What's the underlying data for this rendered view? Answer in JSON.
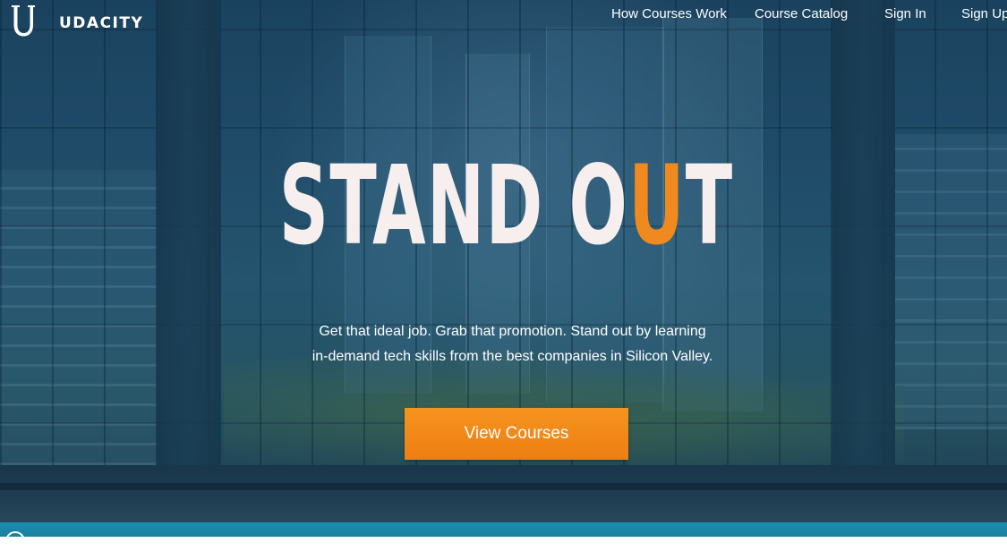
{
  "brand": {
    "name": "UDACITY",
    "logo_icon": "udacity-u-icon"
  },
  "nav": {
    "items": [
      {
        "label": "How Courses Work"
      },
      {
        "label": "Course Catalog"
      },
      {
        "label": "Sign In"
      },
      {
        "label": "Sign Up"
      }
    ]
  },
  "hero": {
    "headline_part1": "STAND O",
    "headline_accent": "U",
    "headline_part2": "T",
    "subtext_line1": "Get that ideal job. Grab that promotion. Stand out by learning",
    "subtext_line2": "in-demand tech skills from the best companies in Silicon Valley.",
    "cta_label": "View Courses"
  },
  "colors": {
    "accent": "#f0891e",
    "button": "#f5931f",
    "bottom_bar": "#1c8fb0",
    "text": "#ffffff"
  }
}
